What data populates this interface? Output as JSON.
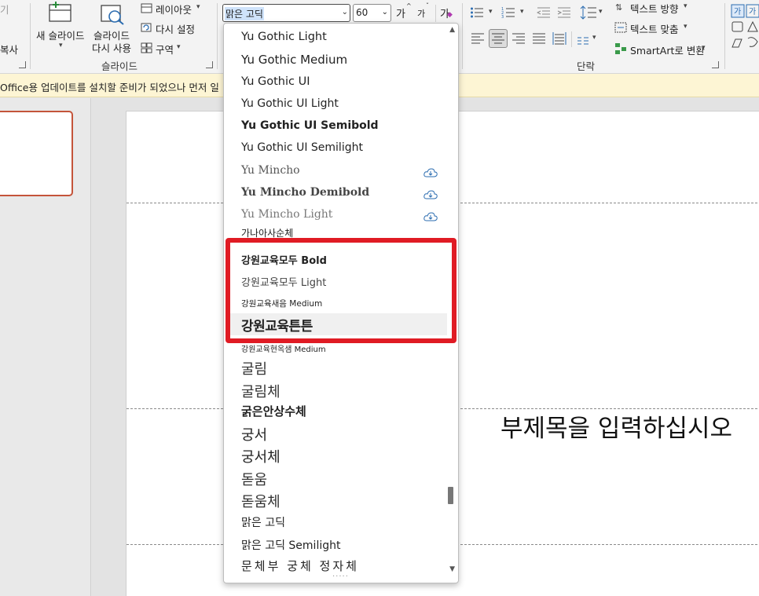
{
  "ribbon": {
    "clipboard_partial_top": "기",
    "clipboard_copy": "복사",
    "new_slide_label_1": "새 슬라이드",
    "reuse_slide_label_1": "슬라이드",
    "reuse_slide_label_2": "다시 사용",
    "layout_label": "레이아웃",
    "reset_label": "다시 설정",
    "section_label": "구역",
    "slides_group": "슬라이드",
    "font_name": "맑은 고딕",
    "font_size": "60",
    "grow_font": "가",
    "shrink_font": "가",
    "clear_format": "가",
    "paragraph_group": "단락",
    "text_direction": "텍스트 방향",
    "align_text": "텍스트 맞춤",
    "smartart": "SmartArt로 변환",
    "shape_labels": [
      "가",
      "가"
    ]
  },
  "notification": {
    "text": "Office용 업데이트를 설치할 준비가 되었으나 먼저 일"
  },
  "slide": {
    "subtitle_placeholder": "부제목을 입력하십시오"
  },
  "font_list": [
    {
      "name": "Yu Gothic Light",
      "cloud": false
    },
    {
      "name": "Yu Gothic Medium",
      "cloud": false
    },
    {
      "name": "Yu Gothic UI",
      "cloud": false
    },
    {
      "name": "Yu Gothic UI Light",
      "cloud": false
    },
    {
      "name": "Yu Gothic UI Semibold",
      "cloud": false
    },
    {
      "name": "Yu Gothic UI Semilight",
      "cloud": false
    },
    {
      "name": "Yu Mincho",
      "cloud": true
    },
    {
      "name": "Yu Mincho Demibold",
      "cloud": true
    },
    {
      "name": "Yu Mincho Light",
      "cloud": true
    },
    {
      "name": "가나아사순체",
      "cloud": false
    },
    {
      "name": "강원교육모두 Bold",
      "cloud": false
    },
    {
      "name": "강원교육모두 Light",
      "cloud": false
    },
    {
      "name": "강원교육새음 Medium",
      "cloud": false
    },
    {
      "name": "강원교육튼튼",
      "cloud": false
    },
    {
      "name": "강원교육현옥샘 Medium",
      "cloud": false
    },
    {
      "name": "굴림",
      "cloud": false
    },
    {
      "name": "굴림체",
      "cloud": false
    },
    {
      "name": "굵은안상수체",
      "cloud": false
    },
    {
      "name": "궁서",
      "cloud": false
    },
    {
      "name": "궁서체",
      "cloud": false
    },
    {
      "name": "돋움",
      "cloud": false
    },
    {
      "name": "돋움체",
      "cloud": false
    },
    {
      "name": "맑은 고딕",
      "cloud": false
    },
    {
      "name": "맑은 고딕 Semilight",
      "cloud": false
    },
    {
      "name": "문체부 궁체 정자체",
      "cloud": false
    }
  ],
  "colors": {
    "highlight": "#e01b24",
    "thumb_border": "#c4543a",
    "notify_bg": "#fdf5d4",
    "selection": "#cfe3fb"
  },
  "icons": {
    "cloud": "cloud-download-icon",
    "scroll_up": "triangle-up",
    "scroll_down": "triangle-down"
  }
}
